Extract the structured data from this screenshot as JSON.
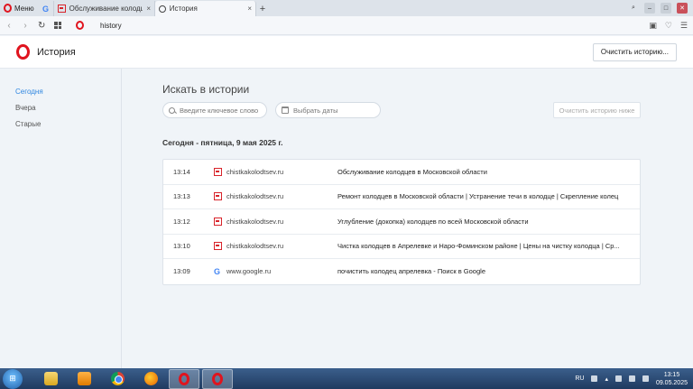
{
  "browser": {
    "menu_label": "Меню",
    "tabs": [
      {
        "title": "",
        "kind": "google",
        "favicon_letter": "G"
      },
      {
        "title": "Обслуживание колодцев",
        "kind": "site",
        "close": "×"
      },
      {
        "title": "История",
        "kind": "history",
        "active": true,
        "close": "×"
      }
    ],
    "new_tab": "+",
    "address": "history",
    "window_controls": [
      "search-icon",
      "minimize-icon",
      "maximize-icon",
      "close-icon"
    ],
    "address_icons": [
      "camera-icon",
      "heart-icon",
      "settings-icon"
    ]
  },
  "header": {
    "title": "История",
    "clear_button": "Очистить историю..."
  },
  "sidebar": {
    "items": [
      {
        "label": "Сегодня",
        "active": true
      },
      {
        "label": "Вчера"
      },
      {
        "label": "Старые"
      }
    ]
  },
  "search": {
    "heading": "Искать в истории",
    "keyword_placeholder": "Введите ключевое слово",
    "date_label": "Выбрать даты",
    "clear_below": "Очистить историю ниже"
  },
  "day_heading": "Сегодня - пятница, 9 мая 2025 г.",
  "history": [
    {
      "time": "13:14",
      "domain": "chistkakolodtsev.ru",
      "title": "Обслуживание колодцев в Московской области",
      "favicon": "site"
    },
    {
      "time": "13:13",
      "domain": "chistkakolodtsev.ru",
      "title": "Ремонт колодцев в Московской области | Устранение течи в колодце | Скрепление колец",
      "favicon": "site"
    },
    {
      "time": "13:12",
      "domain": "chistkakolodtsev.ru",
      "title": "Углубление (докопка) колодцев по всей Московской области",
      "favicon": "site"
    },
    {
      "time": "13:10",
      "domain": "chistkakolodtsev.ru",
      "title": "Чистка колодцев в Апрелевке и Наро-Фоминском районе | Цены на чистку колодца | Ср...",
      "favicon": "site"
    },
    {
      "time": "13:09",
      "domain": "www.google.ru",
      "title": "почистить колодец апрелевка - Поиск в Google",
      "favicon": "google"
    }
  ],
  "taskbar": {
    "lang": "RU",
    "time": "13:15",
    "date": "09.05.2025"
  },
  "colors": {
    "accent": "#2f86e0",
    "opera_red": "#e0141e",
    "background": "#f0f4f8"
  }
}
